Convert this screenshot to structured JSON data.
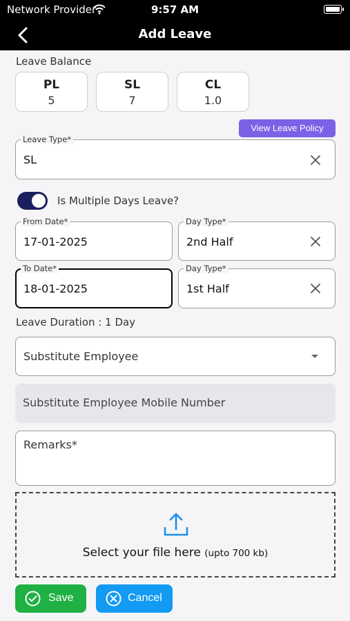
{
  "status_bar": {
    "carrier": "Network Provider",
    "time": "9:57 AM"
  },
  "header": {
    "title": "Add Leave"
  },
  "leave_balance": {
    "heading": "Leave Balance",
    "items": [
      {
        "code": "PL",
        "value": "5"
      },
      {
        "code": "SL",
        "value": "7"
      },
      {
        "code": "CL",
        "value": "1.0"
      }
    ]
  },
  "policy_button": {
    "label": "View Leave Policy"
  },
  "leave_type": {
    "label": "Leave Type*",
    "value": "SL"
  },
  "multiple_days": {
    "label": "Is Multiple Days Leave?",
    "on": true
  },
  "from_date": {
    "label": "From Date*",
    "value": "17-01-2025"
  },
  "from_day_type": {
    "label": "Day Type*",
    "value": "2nd Half"
  },
  "to_date": {
    "label": "To Date*",
    "value": "18-01-2025"
  },
  "to_day_type": {
    "label": "Day Type*",
    "value": "1st Half"
  },
  "duration": {
    "text": "Leave Duration : 1 Day"
  },
  "substitute": {
    "placeholder": "Substitute Employee"
  },
  "substitute_mobile": {
    "placeholder": "Substitute Employee Mobile Number"
  },
  "remarks": {
    "placeholder": "Remarks*"
  },
  "upload": {
    "text": "Select your file here",
    "subtext": "(upto 700 kb)"
  },
  "actions": {
    "save": "Save",
    "cancel": "Cancel"
  },
  "colors": {
    "save": "#1fb144",
    "cancel": "#139af2",
    "policy": "#7b61e6",
    "toggle": "#1c1f5e",
    "upload_icon": "#1e8fe6"
  }
}
